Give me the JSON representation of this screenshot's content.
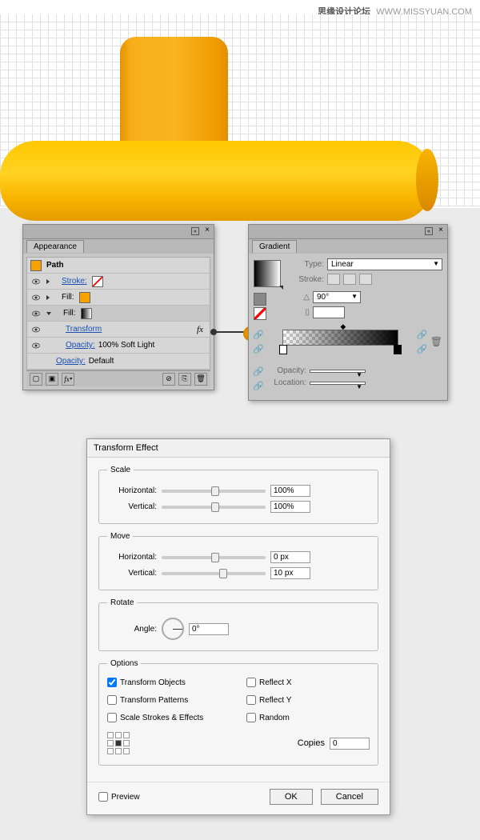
{
  "watermark": {
    "cn": "思缘设计论坛",
    "url": "WWW.MISSYUAN.COM"
  },
  "appearance": {
    "tab": "Appearance",
    "title": "Path",
    "rows": {
      "stroke": "Stroke:",
      "fill1": "Fill:",
      "fill2": "Fill:",
      "transform": "Transform",
      "opacity_label": "Opacity:",
      "opacity_val": "100% Soft Light",
      "opacity2_label": "Opacity:",
      "opacity2_val": "Default"
    }
  },
  "gradient": {
    "tab": "Gradient",
    "type_label": "Type:",
    "type_value": "Linear",
    "stroke_label": "Stroke:",
    "angle_label_sym": "△",
    "angle_value": "90°",
    "ratio_sym": "▯",
    "opacity_label": "Opacity:",
    "location_label": "Location:"
  },
  "transform": {
    "title": "Transform Effect",
    "scale": {
      "legend": "Scale",
      "h_label": "Horizontal:",
      "h_value": "100%",
      "v_label": "Vertical:",
      "v_value": "100%"
    },
    "move": {
      "legend": "Move",
      "h_label": "Horizontal:",
      "h_value": "0 px",
      "v_label": "Vertical:",
      "v_value": "10 px"
    },
    "rotate": {
      "legend": "Rotate",
      "angle_label": "Angle:",
      "angle_value": "0°"
    },
    "options": {
      "legend": "Options",
      "transform_objects": "Transform Objects",
      "transform_patterns": "Transform Patterns",
      "scale_strokes": "Scale Strokes & Effects",
      "reflect_x": "Reflect X",
      "reflect_y": "Reflect Y",
      "random": "Random",
      "copies_label": "Copies",
      "copies_value": "0"
    },
    "preview": "Preview",
    "ok": "OK",
    "cancel": "Cancel"
  }
}
